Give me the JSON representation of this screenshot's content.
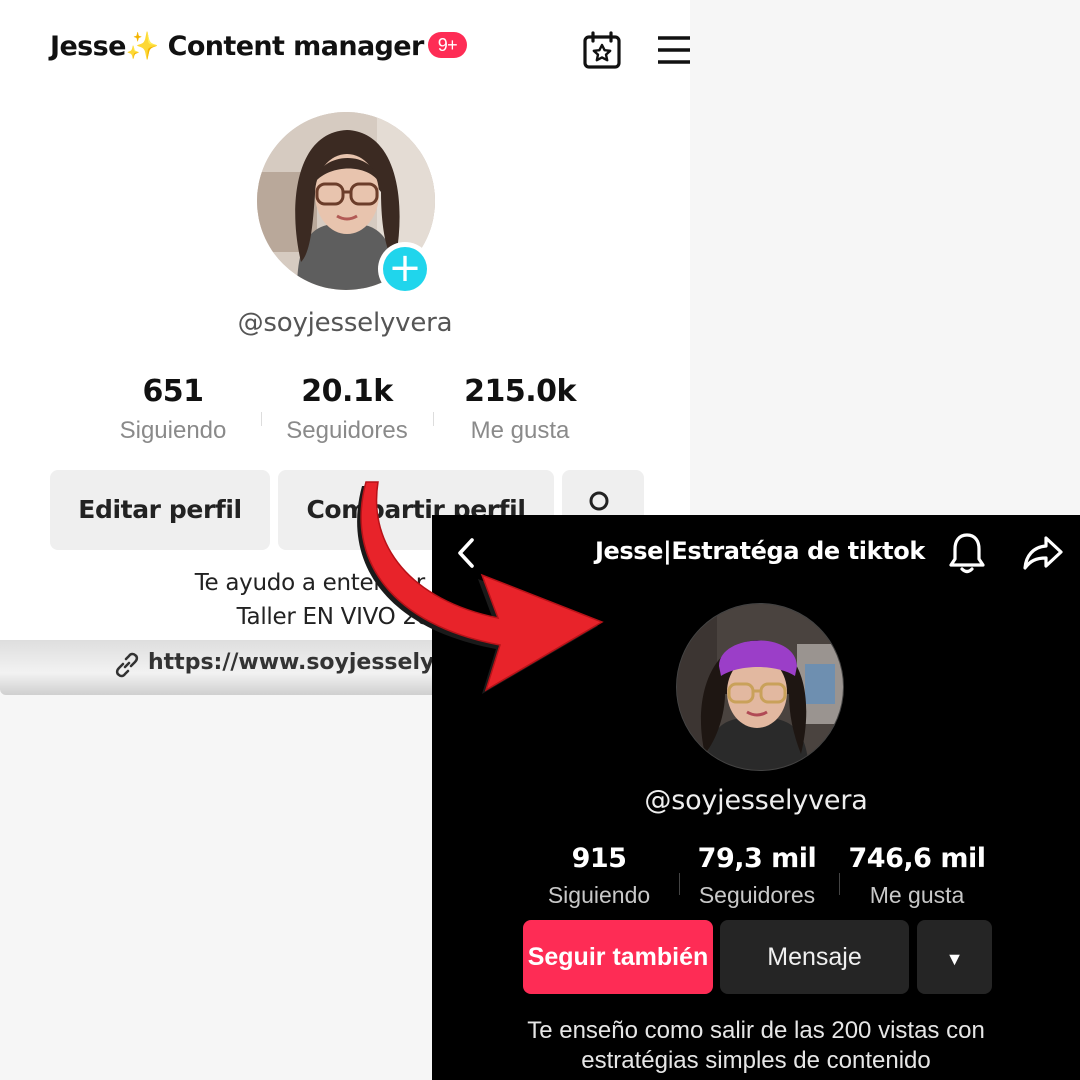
{
  "before": {
    "title": "Jesse✨ Content manager",
    "badge": "9+",
    "handle": "@soyjesselyvera",
    "stats": [
      {
        "value": "651",
        "label": "Siguiendo"
      },
      {
        "value": "20.1k",
        "label": "Seguidores"
      },
      {
        "value": "215.0k",
        "label": "Me gusta"
      }
    ],
    "buttons": {
      "edit": "Editar perfil",
      "share": "Compartir perfil"
    },
    "bio": [
      "Te ayudo a entender tiktok",
      "Taller EN VIVO 28-2"
    ],
    "link": "https://www.soyjesselyv"
  },
  "after": {
    "title": "Jesse|Estratéga de tiktok",
    "handle": "@soyjesselyvera",
    "stats": [
      {
        "value": "915",
        "label": "Siguiendo"
      },
      {
        "value": "79,3 mil",
        "label": "Seguidores"
      },
      {
        "value": "746,6 mil",
        "label": "Me gusta"
      }
    ],
    "buttons": {
      "follow": "Seguir también",
      "message": "Mensaje",
      "dropdown": "▼"
    },
    "bio": [
      "Te enseño como salir de las 200 vistas con",
      "estratégias simples de contenido"
    ]
  },
  "icons": [
    "calendar-icon",
    "menu-icon",
    "plus-icon",
    "add-friend-icon",
    "link-icon",
    "back-icon",
    "bell-icon",
    "share-icon",
    "arrow-icon"
  ],
  "colors": {
    "accent": "#fe2c55",
    "plus": "#20d5ec",
    "arrow": "#e8232a"
  }
}
